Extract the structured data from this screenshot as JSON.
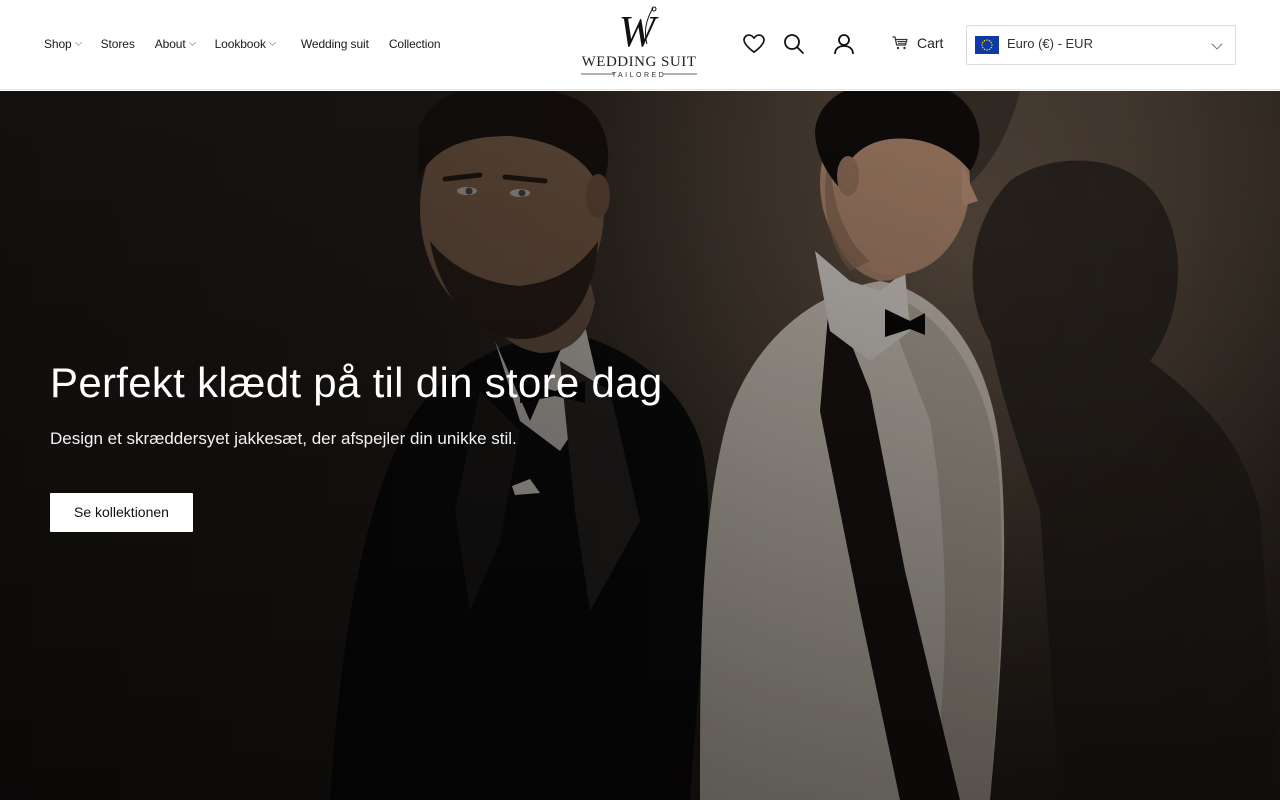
{
  "nav": {
    "items": [
      {
        "label": "Shop",
        "dropdown": true
      },
      {
        "label": "Stores",
        "dropdown": false
      },
      {
        "label": "About",
        "dropdown": true
      },
      {
        "label": "Lookbook",
        "dropdown": true
      },
      {
        "label": "Wedding suit",
        "dropdown": false
      },
      {
        "label": "Collection",
        "dropdown": false
      }
    ]
  },
  "logo": {
    "monogram": "W",
    "name": "WEDDING SUIT",
    "tagline": "TAILORED"
  },
  "header_icons": {
    "wishlist": "heart-icon",
    "search": "search-icon",
    "account": "user-icon",
    "cart_icon": "cart-icon"
  },
  "cart": {
    "label": "Cart"
  },
  "currency": {
    "selected": "Euro (€) - EUR",
    "flag": "eu-flag-icon"
  },
  "hero": {
    "title": "Perfekt klædt på til din store dag",
    "subtitle": "Design et skræddersyet jakkesæt, der afspejler din unikke stil.",
    "cta": "Se kollektionen"
  },
  "colors": {
    "header_bg": "#ffffff",
    "text": "#111111",
    "hero_overlay": "#2b241f",
    "cta_bg": "#ffffff",
    "eu_blue": "#0d3aa6",
    "eu_gold": "#ffcc00"
  }
}
